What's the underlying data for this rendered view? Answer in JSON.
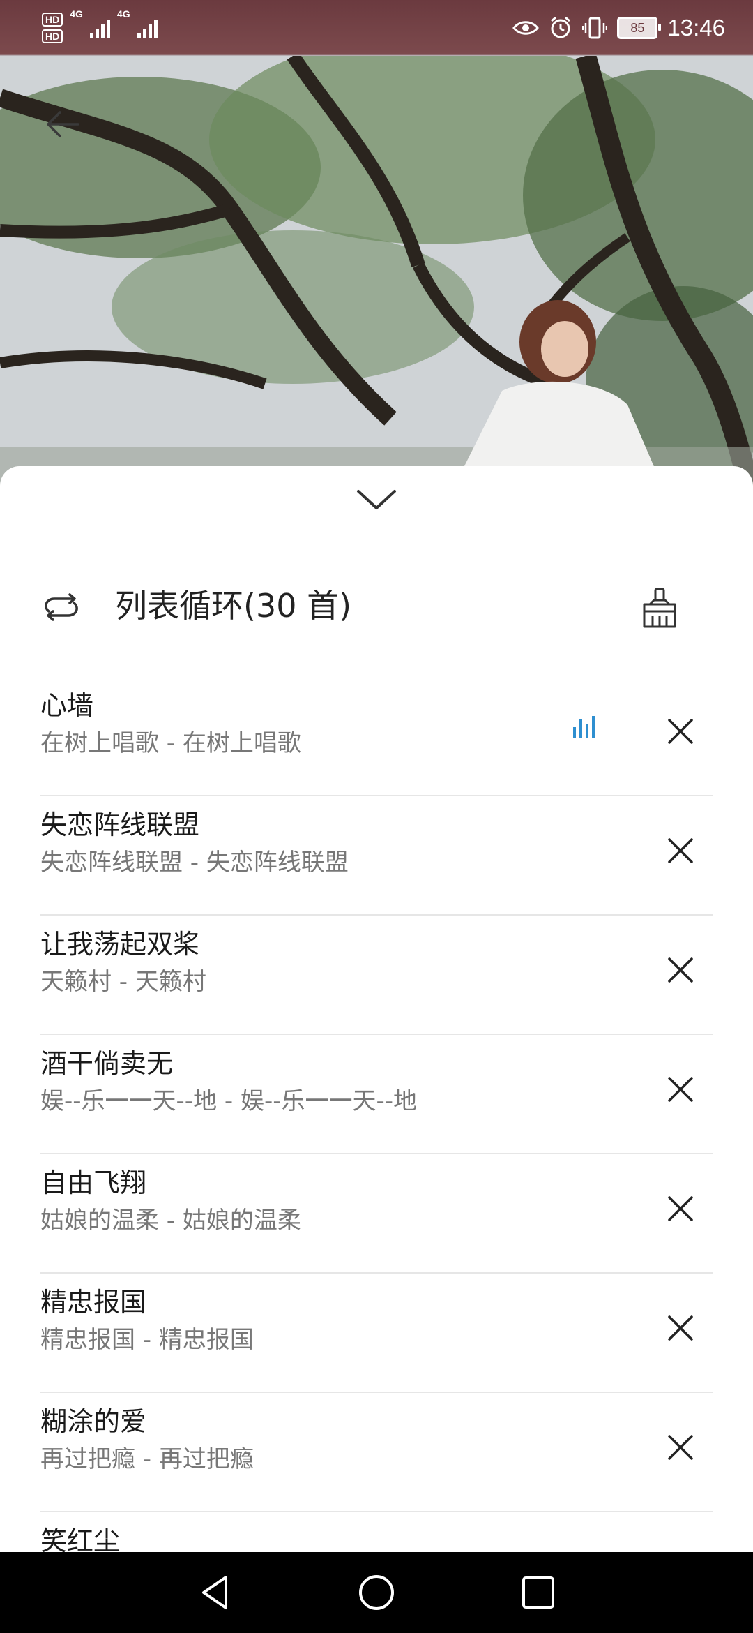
{
  "status_bar": {
    "hd1": "HD",
    "hd2": "HD",
    "network1": "4G",
    "network2": "4G",
    "battery": "85",
    "time": "13:46"
  },
  "header": {
    "play_mode": "列表循环(30 首)"
  },
  "playlist": [
    {
      "title": "心墙",
      "subtitle": "在树上唱歌 - 在树上唱歌",
      "playing": true
    },
    {
      "title": "失恋阵线联盟",
      "subtitle": "失恋阵线联盟 - 失恋阵线联盟",
      "playing": false
    },
    {
      "title": "让我荡起双桨",
      "subtitle": "天籁村 - 天籁村",
      "playing": false
    },
    {
      "title": "酒干倘卖无",
      "subtitle": "娱--乐一一天--地 - 娱--乐一一天--地",
      "playing": false
    },
    {
      "title": "自由飞翔",
      "subtitle": "姑娘的温柔 - 姑娘的温柔",
      "playing": false
    },
    {
      "title": "精忠报国",
      "subtitle": "精忠报国 - 精忠报国",
      "playing": false
    },
    {
      "title": "糊涂的爱",
      "subtitle": "再过把瘾 - 再过把瘾",
      "playing": false
    },
    {
      "title": "笑红尘",
      "subtitle": "",
      "playing": false
    }
  ],
  "colors": {
    "accent": "#2e8fd0",
    "status_bar_bg": "#6b3a3f"
  },
  "icons": {
    "back": "arrow-left-icon",
    "collapse": "chevron-down-icon",
    "play_mode": "repeat-icon",
    "clear": "broom-icon",
    "remove": "close-icon",
    "now_playing": "equalizer-icon",
    "nav_back": "triangle-back-icon",
    "nav_home": "circle-home-icon",
    "nav_recent": "square-recent-icon"
  }
}
